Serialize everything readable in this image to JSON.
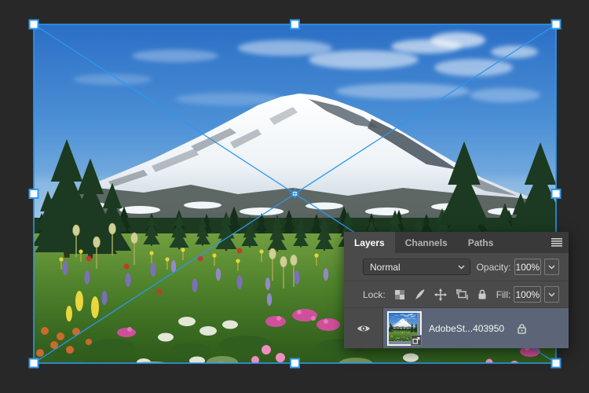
{
  "layers_panel": {
    "tabs": [
      {
        "label": "Layers",
        "active": true
      },
      {
        "label": "Channels",
        "active": false
      },
      {
        "label": "Paths",
        "active": false
      }
    ],
    "blend_mode": "Normal",
    "opacity_label": "Opacity:",
    "opacity_value": "100%",
    "lock_label": "Lock:",
    "lock_tools": [
      "lock-transparency",
      "lock-pixels",
      "lock-position",
      "lock-artboard-nesting",
      "lock-all"
    ],
    "fill_label": "Fill:",
    "fill_value": "100%",
    "layer": {
      "name": "AdobeSt...403950",
      "visible": true,
      "locked": true,
      "selected": true,
      "smart_object": true
    }
  },
  "canvas": {
    "selection_handle_count": 8,
    "transform_active": true
  },
  "colors": {
    "accent_blue": "#2e97ec",
    "canvas_bg": "#282828",
    "panel_bg": "#4a4a4a",
    "tab_strip_bg": "#393939",
    "selected_layer_row": "#5b6577"
  }
}
